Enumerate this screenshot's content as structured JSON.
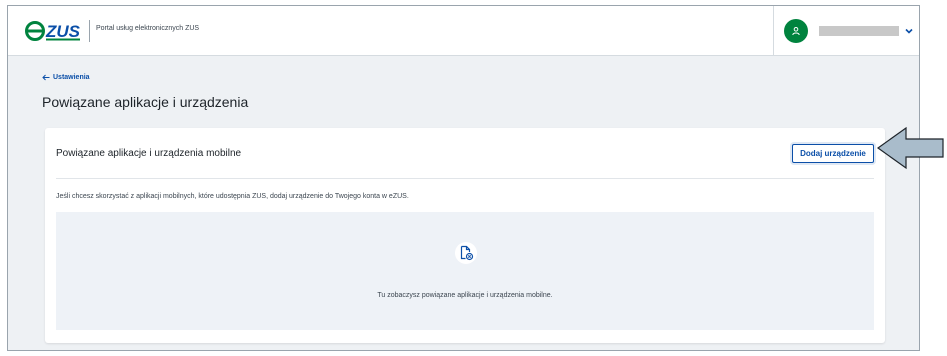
{
  "header": {
    "logo_text": "eZUS",
    "portal_name": "Portal usług elektronicznych ZUS",
    "user_avatar_icon": "user-icon",
    "user_menu_icon": "chevron-down-icon"
  },
  "breadcrumb": {
    "back_label": "Ustawienia",
    "back_icon": "arrow-left-icon"
  },
  "page": {
    "title": "Powiązane aplikacje i urządzenia"
  },
  "card": {
    "title": "Powiązane aplikacje i urządzenia mobilne",
    "add_button_label": "Dodaj urządzenie",
    "info_text": "Jeśli chcesz skorzystać z aplikacji mobilnych, które udostępnia ZUS, dodaj urządzenie do Twojego konta w eZUS.",
    "empty_icon": "document-remove-icon",
    "empty_text": "Tu zobaczysz powiązane aplikacje i urządzenia mobilne."
  },
  "annotation": {
    "icon": "pointer-arrow-icon"
  },
  "colors": {
    "brand_green": "#00833e",
    "brand_blue": "#0b4fa8",
    "page_background": "#eef1f4",
    "empty_panel": "#eef2f7",
    "arrow_fill": "#a9bccb"
  }
}
